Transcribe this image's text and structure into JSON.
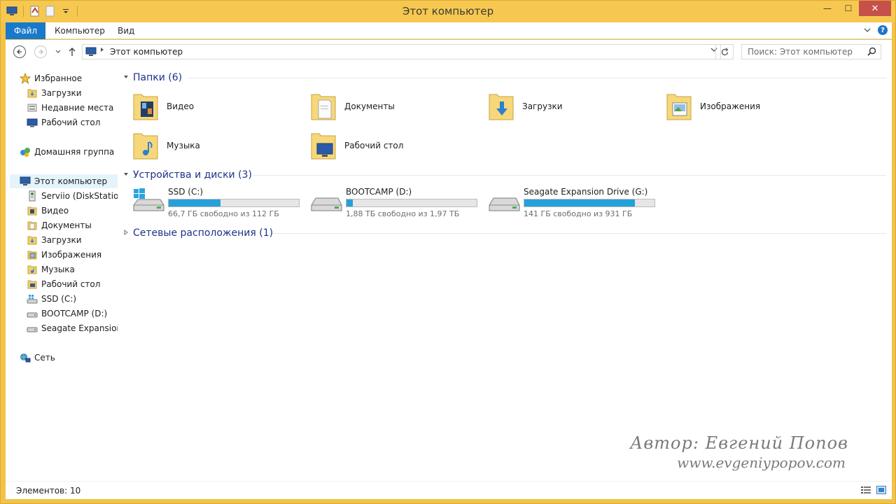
{
  "window": {
    "title": "Этот компьютер",
    "controls": {
      "minimize": "—",
      "maximize": "☐",
      "close": "✕"
    }
  },
  "ribbon": {
    "tabs": [
      {
        "label": "Файл"
      },
      {
        "label": "Компьютер"
      },
      {
        "label": "Вид"
      }
    ]
  },
  "navigation": {
    "address_path": "Этот компьютер",
    "search_placeholder": "Поиск: Этот компьютер"
  },
  "sidebar": {
    "favorites": {
      "label": "Избранное",
      "items": [
        {
          "label": "Загрузки",
          "icon": "downloads-folder-icon"
        },
        {
          "label": "Недавние места",
          "icon": "recent-places-icon"
        },
        {
          "label": "Рабочий стол",
          "icon": "desktop-icon"
        }
      ]
    },
    "homegroup": {
      "label": "Домашняя группа"
    },
    "this_pc": {
      "label": "Этот компьютер",
      "items": [
        {
          "label": "Serviio (DiskStationH",
          "icon": "media-server-icon"
        },
        {
          "label": "Видео",
          "icon": "videos-folder-icon"
        },
        {
          "label": "Документы",
          "icon": "documents-folder-icon"
        },
        {
          "label": "Загрузки",
          "icon": "downloads-folder-icon"
        },
        {
          "label": "Изображения",
          "icon": "pictures-folder-icon"
        },
        {
          "label": "Музыка",
          "icon": "music-folder-icon"
        },
        {
          "label": "Рабочий стол",
          "icon": "desktop-folder-icon"
        },
        {
          "label": "SSD (C:)",
          "icon": "system-drive-icon"
        },
        {
          "label": "BOOTCAMP (D:)",
          "icon": "drive-icon"
        },
        {
          "label": "Seagate Expansion D",
          "icon": "drive-icon"
        }
      ]
    },
    "network": {
      "label": "Сеть"
    }
  },
  "main": {
    "folders_group": {
      "title": "Папки (6)"
    },
    "folders": [
      {
        "label": "Видео",
        "icon": "videos-folder-icon"
      },
      {
        "label": "Документы",
        "icon": "documents-folder-icon"
      },
      {
        "label": "Загрузки",
        "icon": "downloads-folder-icon"
      },
      {
        "label": "Изображения",
        "icon": "pictures-folder-icon"
      },
      {
        "label": "Музыка",
        "icon": "music-folder-icon"
      },
      {
        "label": "Рабочий стол",
        "icon": "desktop-folder-icon"
      }
    ],
    "devices_group": {
      "title": "Устройства и диски (3)"
    },
    "drives": [
      {
        "name": "SSD (C:)",
        "free_text": "66,7 ГБ свободно из 112 ГБ",
        "used_fraction": 0.4,
        "icon": "system-drive-icon"
      },
      {
        "name": "BOOTCAMP (D:)",
        "free_text": "1,88 ТБ свободно из 1,97 ТБ",
        "used_fraction": 0.05,
        "icon": "drive-icon"
      },
      {
        "name": "Seagate Expansion Drive (G:)",
        "free_text": "141 ГБ свободно из 931 ГБ",
        "used_fraction": 0.85,
        "icon": "drive-icon"
      }
    ],
    "network_group": {
      "title": "Сетевые расположения (1)"
    }
  },
  "watermark": {
    "line1": "Автор:  Евгений  Попов",
    "line2": "www.evgeniypopov.com"
  },
  "status": {
    "items_count": "Элементов: 10"
  },
  "colors": {
    "accent": "#1979ca",
    "frame": "#f6c84f",
    "drive_fill": "#26a0da",
    "group_header": "#1e3287"
  }
}
